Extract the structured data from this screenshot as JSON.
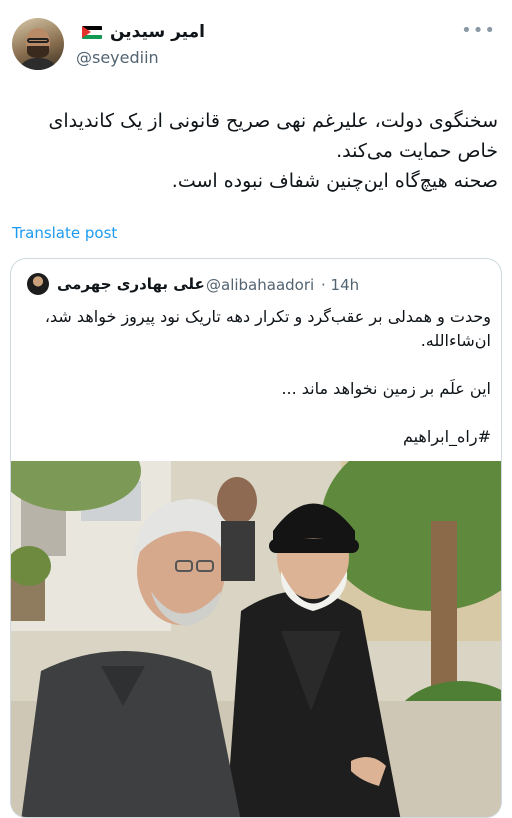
{
  "tweet": {
    "author_name": "امیر سیدین",
    "author_handle": "@seyediin",
    "text_lines": [
      "سخنگوی دولت، علیرغم نهی صریح قانونی از یک کاندیدای خاص حمایت می‌کند.",
      "صحنه هیچ‌گاه این‌چنین شفاف نبوده است."
    ],
    "translate_label": "Translate post",
    "more_icon": "more-horizontal-icon"
  },
  "quote": {
    "author_name": "علی بهادری جهرمی",
    "author_handle": "@alibahaadori",
    "time": "· 14h",
    "text_lines": [
      "وحدت و همدلی بر عقب‌گرد و تکرار دهه تاریک نود پیروز خواهد شد، ان‌شاءالله.",
      "این علَم بر زمین نخواهد ماند ...",
      "#راه_ابراهیم"
    ]
  },
  "colors": {
    "link": "#1d9bf0",
    "secondary_text": "#536471",
    "border": "#cfd9de"
  }
}
